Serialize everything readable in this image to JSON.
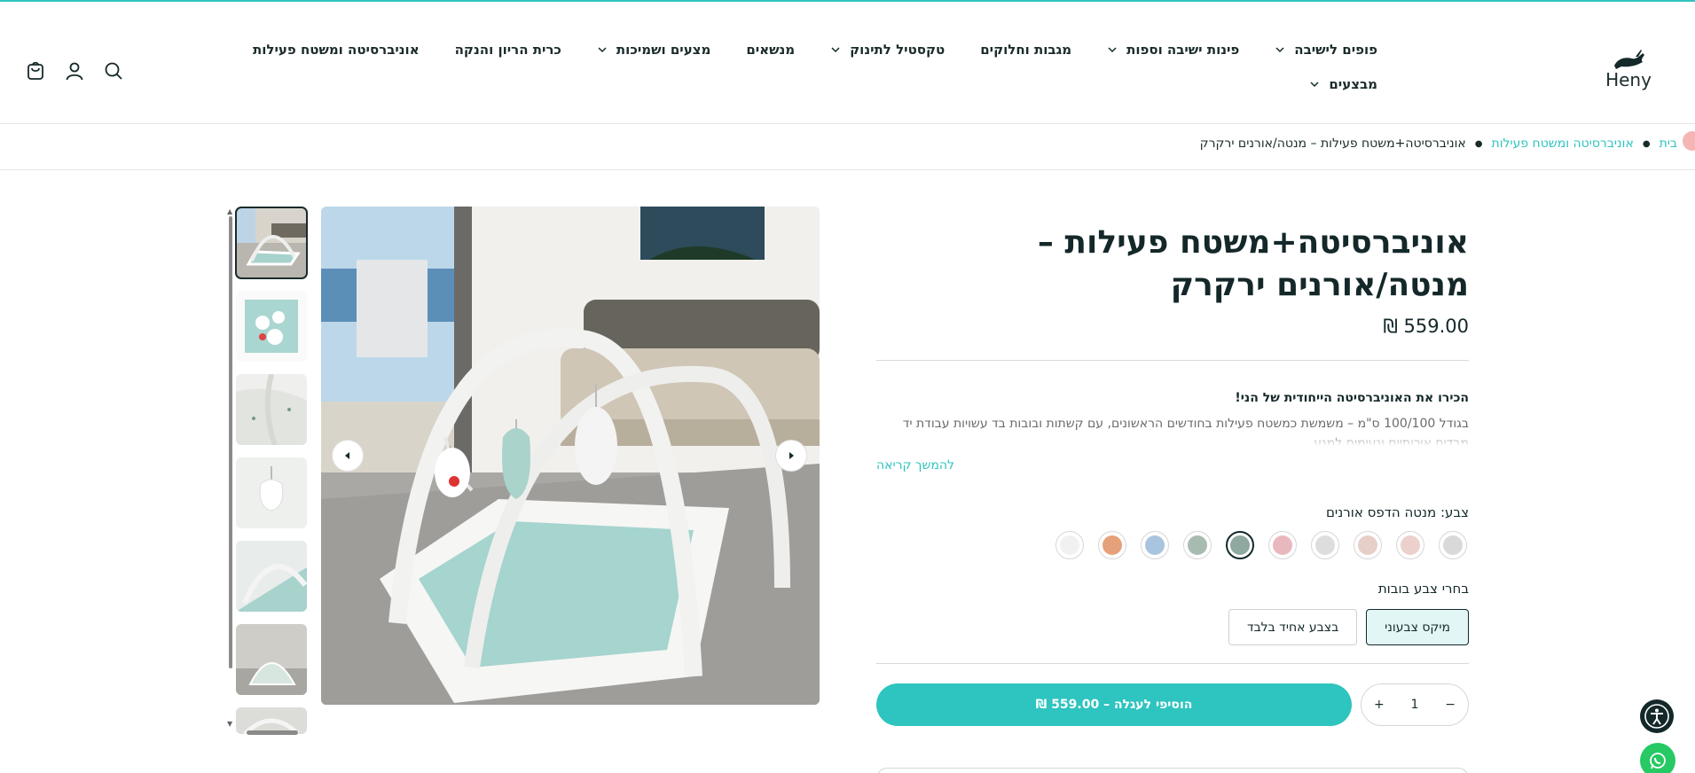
{
  "header": {
    "logo_text": "Heny",
    "nav_row1": [
      {
        "label": "פופים לישיבה",
        "dropdown": true
      },
      {
        "label": "פינות ישיבה וספות",
        "dropdown": true
      },
      {
        "label": "מגבות וחלוקים",
        "dropdown": false
      },
      {
        "label": "טקסטיל לתינוק",
        "dropdown": true
      },
      {
        "label": "מנשאים",
        "dropdown": false
      },
      {
        "label": "מצעים ושמיכות",
        "dropdown": true
      },
      {
        "label": "כרית הריון והנקה",
        "dropdown": false
      },
      {
        "label": "אוניברסיטה ומשטח פעילות",
        "dropdown": false
      }
    ],
    "nav_row2": [
      {
        "label": "מבצעים",
        "dropdown": true
      }
    ],
    "icons": [
      "search-icon",
      "account-icon",
      "cart-icon"
    ]
  },
  "breadcrumb": {
    "home": "בית",
    "category": "אוניברסיטה ומשטח פעילות",
    "current": "אוניברסיטה+משטח פעילות – מנטה/אורנים ירקרק"
  },
  "product": {
    "title": "אוניברסיטה+משטח פעילות – מנטה/אורנים ירקרק",
    "price": "559.00 ₪",
    "desc_title": "הכירו את האוניברסיטה הייחודית של הני!",
    "desc_body": "בגודל 100/100 ס\"מ – משמשת כמשטח פעילות בחודשים הראשונים, עם קשתות ובובות בד עשויות עבודת יד מבדים איכותיים ונעימים למגע",
    "read_more": "להמשך קריאה",
    "color_label": "צבע: מנטה הדפס אורנים",
    "swatches": [
      "#d9d9d9",
      "#ecd0cb",
      "#e6cfc8",
      "#dddddd",
      "#e9b8bf",
      "#8fa8a0",
      "#a8bbb0",
      "#a9c4de",
      "#e6a07a",
      "#f1f1f1"
    ],
    "selected_swatch": 5,
    "bubble_label": "בחרי צבע בובות",
    "options": [
      {
        "label": "מיקס צבעוני",
        "selected": true
      },
      {
        "label": "בצבע אחיד בלבד",
        "selected": false
      }
    ],
    "quantity": "1",
    "add_to_cart": "הוסיפי לעגלה – 559.00 ₪"
  },
  "colors": {
    "accent": "#2ec4bf",
    "text": "#14282a",
    "whatsapp": "#26c963"
  }
}
